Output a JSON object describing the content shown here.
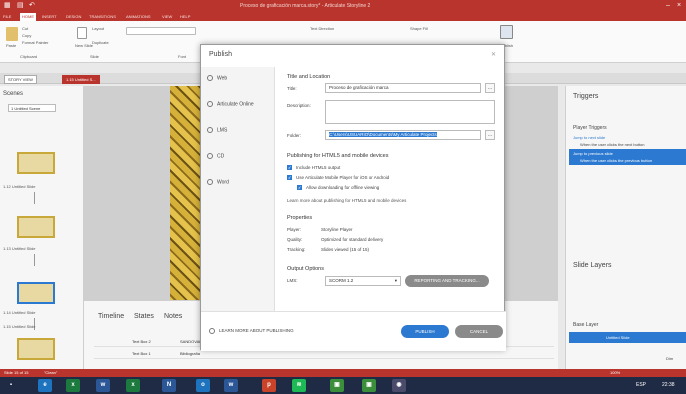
{
  "app": {
    "title": "Proceso de graficación marca.story* - Articulate Storyline 2",
    "file_tab": "FILE",
    "tabs": [
      "HOME",
      "INSERT",
      "DESIGN",
      "TRANSITIONS",
      "ANIMATIONS",
      "VIEW",
      "HELP"
    ]
  },
  "ribbon": {
    "cut": "Cut",
    "copy": "Copy",
    "paste": "Paste",
    "format_painter": "Format Painter",
    "new_slide": "New Slide",
    "layout": "Layout",
    "duplicate": "Duplicate",
    "clipboard": "Clipboard",
    "slide": "Slide",
    "font": "Font",
    "text_direction": "Text Direction",
    "shape_fill": "Shape Fill",
    "publish": "Publish"
  },
  "viewtabs": {
    "story_view": "STORY VIEW",
    "untitled": "1.15 Untitled S..."
  },
  "scenes": {
    "title": "Scenes",
    "scene_select": "1 Untitled Scene",
    "slides": [
      "1.12 Untitled Slide",
      "1.13 Untitled Slide",
      "1.14 Untitled Slide",
      "1.15 Untitled Slide"
    ]
  },
  "bottom": {
    "tabs": [
      "Timeline",
      "States",
      "Notes"
    ],
    "rows": [
      "Text Box 2",
      "Text Box 1"
    ],
    "row_values": [
      "SANDOVAL",
      "Bibliografía"
    ]
  },
  "right": {
    "triggers_title": "Triggers",
    "player_triggers": "Player Triggers",
    "jump1": "Jump to next slide",
    "when1": "When the user clicks the next button",
    "jump2": "Jump to previous slide",
    "when2": "When the user clicks the previous button",
    "slide_layers": "Slide Layers",
    "base_layer": "Base Layer",
    "untitled_slide": "Untitled Slide",
    "dim": "Dim"
  },
  "status": {
    "slide": "Slide 15 of 15",
    "theme": "\"Clean\"",
    "zoom": "100%"
  },
  "taskbar": {
    "lang": "ESP",
    "time": "22:38"
  },
  "dialog": {
    "title": "Publish",
    "nav": [
      "Web",
      "Articulate Online",
      "LMS",
      "CD",
      "Word"
    ],
    "section_title": "Title and Location",
    "title_label": "Title:",
    "title_value": "Proceso de graficación marca",
    "description_label": "Description:",
    "folder_label": "Folder:",
    "folder_value": "C:\\Users\\USUARIO\\Documents\\My Articulate Projects",
    "html5_title": "Publishing for HTML5 and mobile devices",
    "include_html5": "Include HTML5 output",
    "use_mobile": "Use Articulate Mobile Player for iOS or Android",
    "allow_offline": "Allow downloading for offline viewing",
    "learn_more_html5": "Learn more about publishing for HTML5 and mobile devices",
    "properties": "Properties",
    "player_label": "Player:",
    "player_value": "Storyline Player",
    "quality_label": "Quality:",
    "quality_value": "Optimized for standard delivery",
    "tracking_label": "Tracking:",
    "tracking_value": "Slides viewed (15 of 15)",
    "output_options": "Output Options",
    "lms_label": "LMS:",
    "lms_value": "SCORM 1.2",
    "reporting": "REPORTING AND TRACKING...",
    "learn_more": "LEARN MORE ABOUT PUBLISHING",
    "publish": "PUBLISH",
    "cancel": "CANCEL"
  },
  "colors": {
    "accent": "#b9342d",
    "primary_button": "#2b79d1",
    "cancel_button": "#8a8a8a",
    "selection": "#2b79d1"
  }
}
